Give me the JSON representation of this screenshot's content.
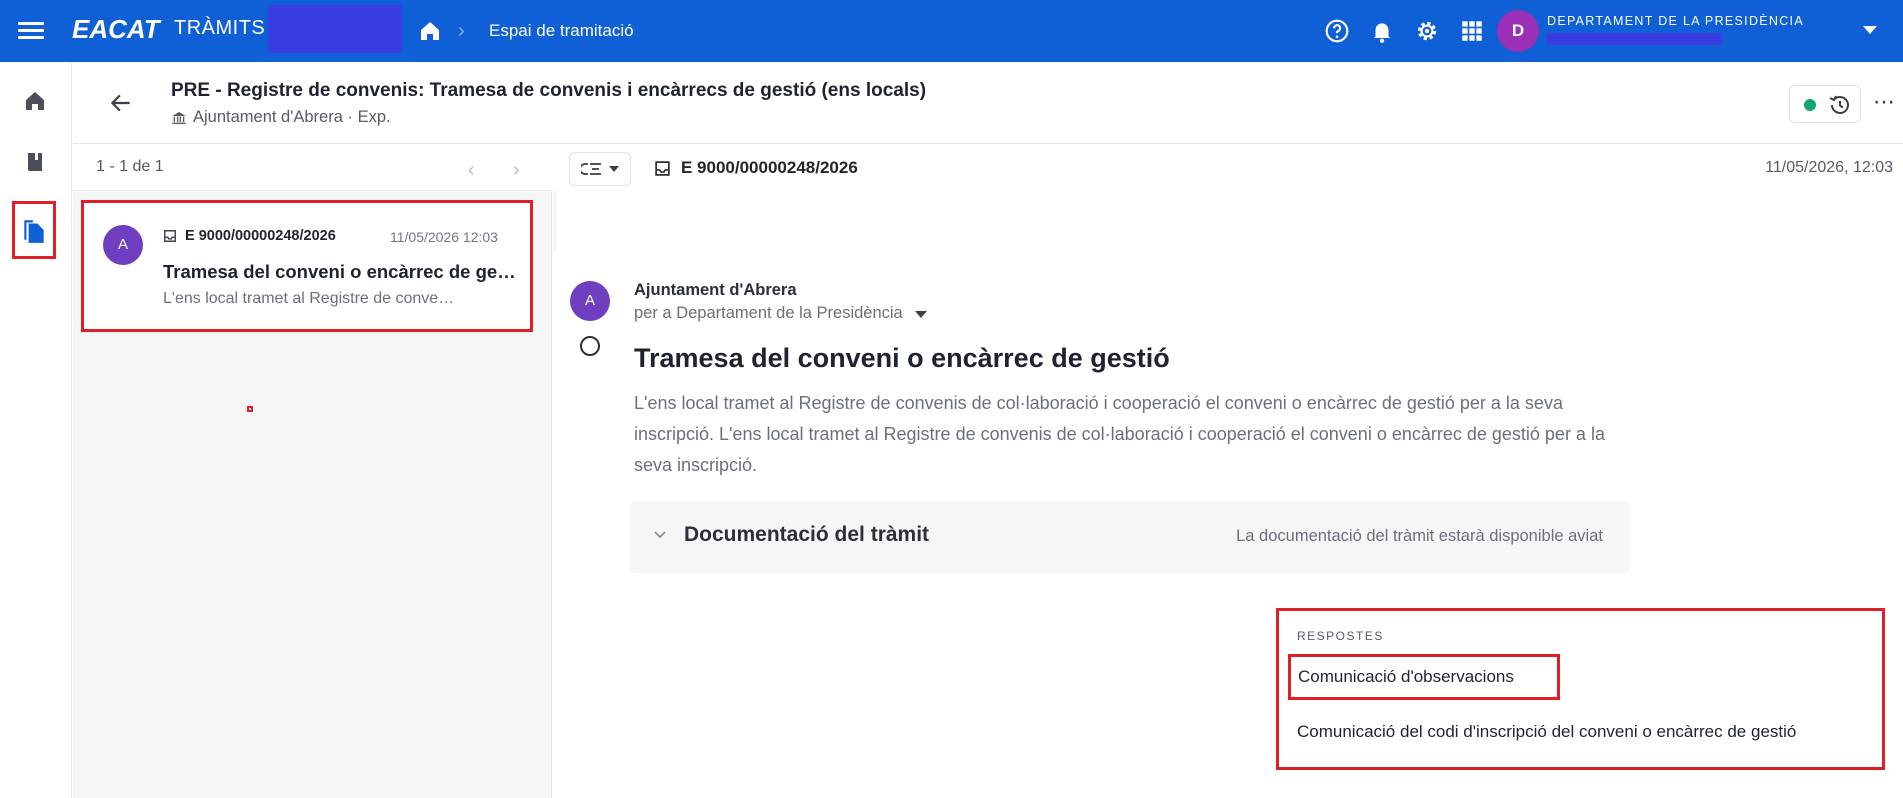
{
  "topbar": {
    "brand": "EACAT",
    "brand_sub": "TRÀMITS",
    "breadcrumb": "Espai de tramitació",
    "avatar_initial": "D",
    "department": "DEPARTAMENT DE LA PRESIDÈNCIA",
    "icons": [
      "help-icon",
      "bell-icon",
      "gear-icon",
      "apps-grid-icon"
    ]
  },
  "rail": {
    "items": [
      "home-icon",
      "book-icon",
      "documents-icon"
    ]
  },
  "header": {
    "title": "PRE - Registre de convenis: Tramesa de convenis i encàrrecs de gestió (ens locals)",
    "subtitle": "Ajuntament d'Abrera · Exp."
  },
  "list": {
    "pager": "1 - 1 de 1",
    "items": [
      {
        "avatar": "A",
        "ref": "E 9000/00000248/2026",
        "date": "11/05/2026 12:03",
        "title": "Tramesa del conveni o encàrrec de gestió",
        "snippet": "L'ens local tramet al Registre de convenis de col·laboració i cooperació"
      }
    ]
  },
  "detail": {
    "ref": "E 9000/00000248/2026",
    "date": "11/05/2026, 12:03",
    "avatar": "A",
    "from": "Ajuntament d'Abrera",
    "to": "per a Departament de la Presidència",
    "title": "Tramesa del conveni o encàrrec de gestió",
    "body": "L'ens local tramet al Registre de convenis de col·laboració i cooperació el conveni o encàrrec de gestió per a la seva inscripció. L'ens local tramet al Registre de convenis de col·laboració i cooperació el conveni o encàrrec de gestió per a la seva inscripció.",
    "doc_title": "Documentació del tràmit",
    "doc_note": "La documentació del tràmit estarà disponible aviat"
  },
  "responses": {
    "heading": "RESPOSTES",
    "items": [
      "Comunicació d'observacions",
      "Comunicació del codi d'inscripció del conveni o encàrrec de gestió"
    ]
  },
  "colors": {
    "topbar": "#0f5fd6",
    "accent": "#0f5fd6",
    "avatar_user": "#9a2fb8",
    "avatar_entity": "#6f3ec1",
    "status_ok": "#12a66b",
    "highlight": "#e01e28"
  }
}
